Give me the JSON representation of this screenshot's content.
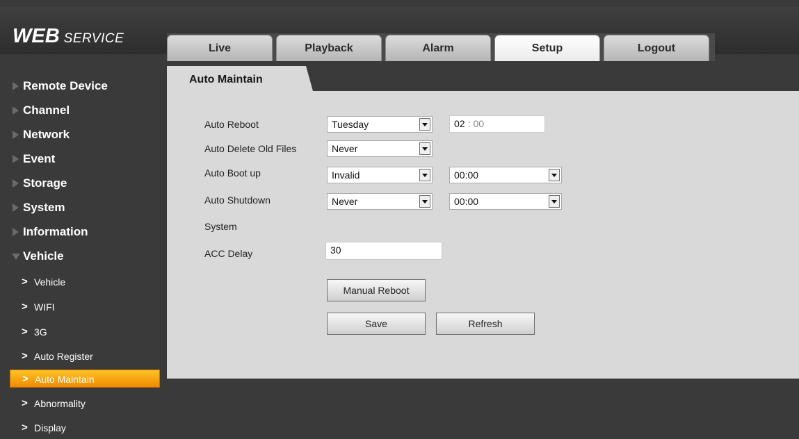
{
  "header": {
    "logo_big": "WEB",
    "logo_small": "SERVICE",
    "tabs": [
      {
        "label": "Live"
      },
      {
        "label": "Playback"
      },
      {
        "label": "Alarm"
      },
      {
        "label": "Setup"
      },
      {
        "label": "Logout"
      }
    ],
    "active_tab": "Setup"
  },
  "sidebar": {
    "items": [
      {
        "label": "Remote Device",
        "expanded": false
      },
      {
        "label": "Channel",
        "expanded": false
      },
      {
        "label": "Network",
        "expanded": false
      },
      {
        "label": "Event",
        "expanded": false
      },
      {
        "label": "Storage",
        "expanded": false
      },
      {
        "label": "System",
        "expanded": false
      },
      {
        "label": "Information",
        "expanded": false
      },
      {
        "label": "Vehicle",
        "expanded": true
      }
    ],
    "sub_items": [
      {
        "label": "Vehicle"
      },
      {
        "label": "WIFI"
      },
      {
        "label": "3G"
      },
      {
        "label": "Auto Register"
      },
      {
        "label": "Auto Maintain"
      },
      {
        "label": "Abnormality"
      },
      {
        "label": "Display"
      }
    ],
    "active_sub_item": "Auto Maintain",
    "chevron": ">"
  },
  "panel": {
    "title": "Auto Maintain",
    "auto_reboot": {
      "label": "Auto Reboot",
      "day": "Tuesday",
      "hour": "02",
      "separator": ":",
      "minute": "00"
    },
    "auto_delete": {
      "label": "Auto Delete Old Files",
      "value": "Never"
    },
    "auto_boot": {
      "label": "Auto Boot up",
      "value": "Invalid",
      "time": "00:00"
    },
    "auto_shutdown": {
      "label_line1": "Auto Shutdown",
      "label_line2": "System",
      "value": "Never",
      "time": "00:00"
    },
    "acc_delay": {
      "label": "ACC Delay",
      "value": "30"
    },
    "buttons": {
      "manual_reboot": "Manual Reboot",
      "save": "Save",
      "refresh": "Refresh"
    }
  },
  "colors": {
    "background_dark": "#3a3a3a",
    "panel_gray": "#d9d9d9",
    "active_orange": "#f5a000"
  }
}
